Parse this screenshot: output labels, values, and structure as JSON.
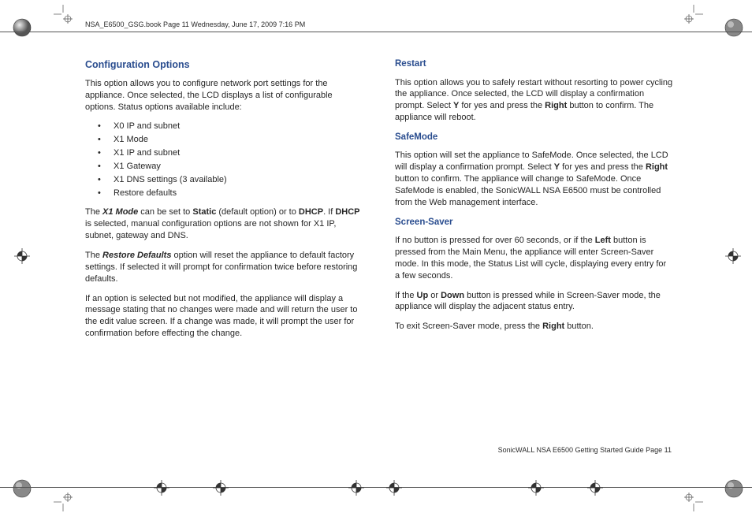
{
  "header": {
    "running_line": "NSA_E6500_GSG.book  Page 11  Wednesday, June 17, 2009  7:16 PM"
  },
  "left": {
    "h_config": "Configuration Options",
    "p_config_intro": "This option allows you to configure network port settings for the appliance. Once selected, the LCD displays a list of configurable options. Status options available include:",
    "bullets": {
      "b0": "X0 IP and subnet",
      "b1": "X1 Mode",
      "b2": "X1 IP and subnet",
      "b3": "X1 Gateway",
      "b4": "X1 DNS settings (3 available)",
      "b5": "Restore defaults"
    },
    "p_x1_pre": "The ",
    "p_x1_bi": "X1 Mode",
    "p_x1_mid1": " can be set to ",
    "p_x1_b1": "Static",
    "p_x1_mid2": " (default option) or to ",
    "p_x1_b2": "DHCP",
    "p_x1_mid3": ". If ",
    "p_x1_b3": "DHCP",
    "p_x1_end": " is selected, manual configuration options are not shown for X1 IP, subnet, gateway and DNS.",
    "p_rd_pre": "The ",
    "p_rd_bi": "Restore Defaults",
    "p_rd_end": " option will reset the appliance to default factory settings. If selected it will prompt for confirmation twice before restoring defaults.",
    "p_unsaved": "If an option is selected but not modified, the appliance will display a message stating that no changes were made and will return the user to the edit value screen. If a change was made, it will prompt the user for confirmation before effecting the change."
  },
  "right": {
    "h_restart": "Restart",
    "p_restart_a": "This option allows you to safely restart without resorting to power cycling the appliance. Once selected, the LCD will display a confirmation prompt. Select ",
    "p_restart_y": "Y",
    "p_restart_b": " for yes and press the ",
    "p_restart_right": "Right",
    "p_restart_c": " button to confirm. The appliance will reboot.",
    "h_safemode": "SafeMode",
    "p_sm_a": "This option will set the appliance to SafeMode. Once selected, the LCD will display a confirmation prompt. Select ",
    "p_sm_y": "Y",
    "p_sm_b": " for yes and press the ",
    "p_sm_right": "Right",
    "p_sm_c": " button to confirm. The appliance will change to SafeMode. Once SafeMode is enabled, the SonicWALL NSA E6500 must be controlled from the Web management interface.",
    "h_ss": "Screen-Saver",
    "p_ss_a": "If no button is pressed for over 60 seconds, or if the ",
    "p_ss_left": "Left",
    "p_ss_b": " button is pressed from the Main Menu, the appliance will enter Screen-Saver mode. In this mode, the Status List will cycle, displaying every entry for a few seconds.",
    "p_ss2_a": "If the ",
    "p_ss2_up": "Up",
    "p_ss2_or": " or ",
    "p_ss2_down": "Down",
    "p_ss2_b": " button is pressed while in Screen-Saver mode, the appliance will display the adjacent status entry.",
    "p_ss3_a": "To exit Screen-Saver mode, press the ",
    "p_ss3_right": "Right",
    "p_ss3_b": " button."
  },
  "footer": {
    "guide_title": "SonicWALL NSA E6500 Getting Started Guide",
    "page_label": "  Page 11"
  }
}
